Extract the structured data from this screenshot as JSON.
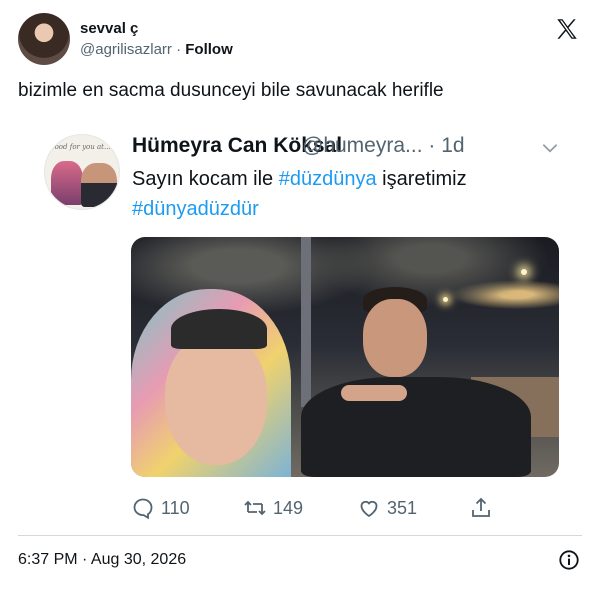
{
  "author": {
    "display_name": "sevval ç",
    "handle": "@agrilisazlarr",
    "separator": "·",
    "follow_label": "Follow"
  },
  "tweet": {
    "text": "bizimle en sacma dusunceyi bile savunacak herifle",
    "timestamp": "6:37 PM · Aug 30, 2026"
  },
  "quoted": {
    "display_name": "Hümeyra Can Köksal",
    "handle": "@humeyra...",
    "time": "· 1d",
    "text_plain": "Sayın kocam ile ",
    "hashtag1": "#düzdünya",
    "text_after": " işaretimiz",
    "hashtag2": "#dünyadüzdür",
    "avatar_caption": "Good for you at..."
  },
  "actions": {
    "replies": "110",
    "retweets": "149",
    "likes": "351"
  },
  "colors": {
    "link": "#1d9bf0",
    "secondary_text": "#536471",
    "divider": "#cfd9de"
  }
}
